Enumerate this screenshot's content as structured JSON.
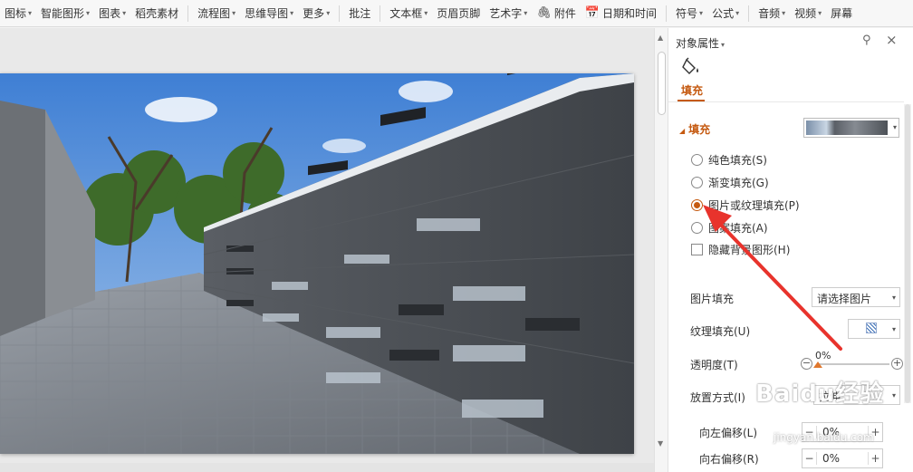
{
  "ribbon": {
    "items": [
      {
        "label": "图标",
        "has_arrow": true
      },
      {
        "label": "智能图形",
        "has_arrow": true
      },
      {
        "label": "图表",
        "has_arrow": true
      },
      {
        "label": "稻壳素材",
        "has_arrow": false
      },
      {
        "label": "流程图",
        "has_arrow": true
      },
      {
        "label": "思维导图",
        "has_arrow": true
      },
      {
        "label": "更多",
        "has_arrow": true
      },
      {
        "label": "批注",
        "has_arrow": false
      },
      {
        "label": "文本框",
        "has_arrow": true
      },
      {
        "label": "页眉页脚",
        "has_arrow": false
      },
      {
        "label": "艺术字",
        "has_arrow": true
      },
      {
        "label": "附件",
        "has_arrow": false,
        "icon": "paperclip-icon"
      },
      {
        "label": "日期和时间",
        "has_arrow": false,
        "icon": "calendar-icon"
      },
      {
        "label": "符号",
        "has_arrow": true
      },
      {
        "label": "公式",
        "has_arrow": true
      },
      {
        "label": "音频",
        "has_arrow": true
      },
      {
        "label": "视频",
        "has_arrow": true
      },
      {
        "label": "屏幕",
        "has_arrow": false
      }
    ]
  },
  "pane": {
    "title": "对象属性",
    "tab": "填充",
    "section": "填充",
    "options": {
      "solid": "纯色填充(S)",
      "gradient": "渐变填充(G)",
      "picture": "图片或纹理填充(P)",
      "pattern": "图案填充(A)",
      "hide_bg": "隐藏背景图形(H)"
    },
    "selected_option": "picture",
    "picture_fill_label": "图片填充",
    "picture_fill_value": "请选择图片",
    "texture_fill_label": "纹理填充(U)",
    "transparency_label": "透明度(T)",
    "transparency_value": "0%",
    "transparency_fraction": 0,
    "placement_label": "放置方式(I)",
    "placement_value": "拉伸",
    "offset_left_label": "向左偏移(L)",
    "offset_left_value": "0%",
    "offset_right_label": "向右偏移(R)",
    "offset_right_value": "0%"
  },
  "watermark": {
    "brand": "Baidu经验",
    "url": "jingyan.baidu.com"
  },
  "colors": {
    "accent": "#c55a11",
    "annotation_arrow": "#e8332c"
  }
}
